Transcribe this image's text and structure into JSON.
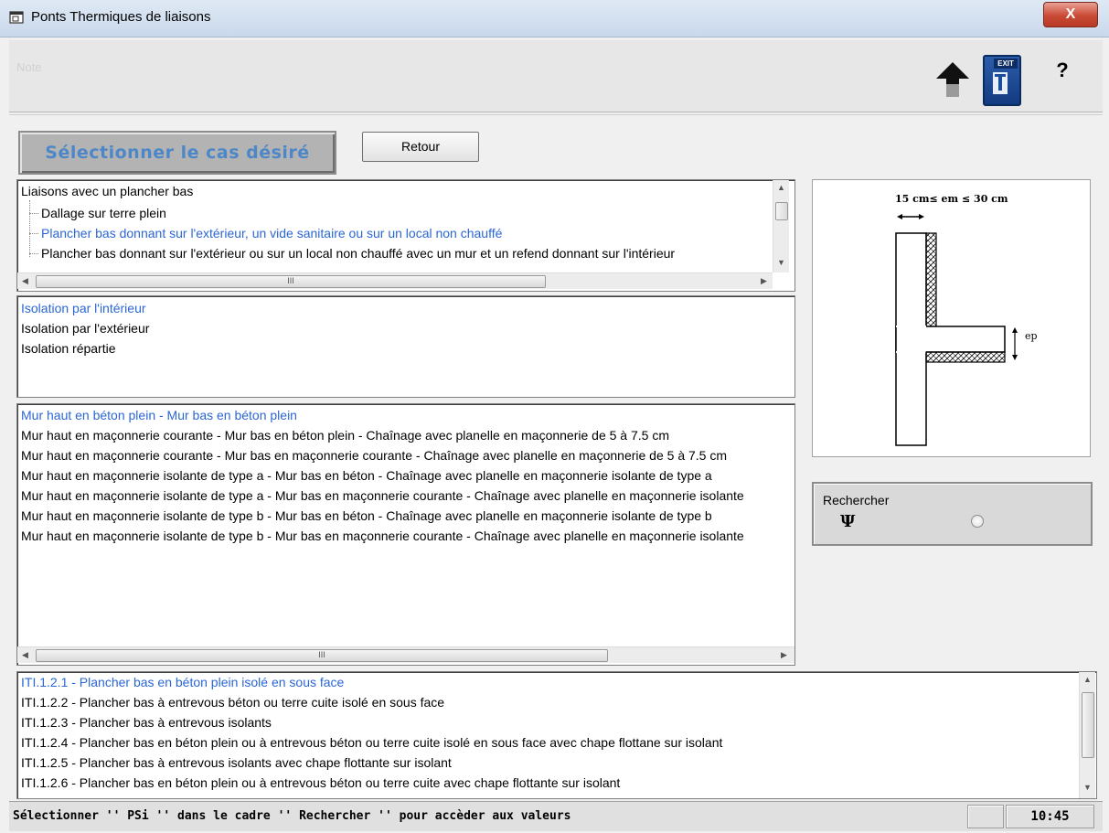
{
  "window": {
    "title": "Ponts Thermiques de liaisons",
    "close_glyph": "X",
    "header_faint_text": "Note"
  },
  "toolbar": {
    "up_icon": "up-arrow-icon",
    "exit_label": "EXIT",
    "help_glyph": "?"
  },
  "header": {
    "select_label": "Sélectionner le cas désiré",
    "retour_label": "Retour"
  },
  "liaisons_tree": {
    "root": "Liaisons avec un plancher bas",
    "children": [
      "Dallage sur terre plein",
      "Plancher bas donnant sur l'extérieur, un vide sanitaire ou sur un local non chauffé",
      "Plancher bas donnant sur l'extérieur ou sur un local non chauffé avec un mur et un refend donnant sur l'intérieur"
    ],
    "selected_index": 1
  },
  "isolation_list": {
    "items": [
      "Isolation par l'intérieur",
      "Isolation par l'extérieur",
      "Isolation répartie"
    ],
    "selected_index": 0
  },
  "mur_list": {
    "items": [
      "Mur haut en béton plein - Mur bas en béton plein",
      "Mur haut en maçonnerie courante - Mur bas en béton plein - Chaînage avec planelle en maçonnerie de 5 à 7.5 cm",
      "Mur haut en maçonnerie courante - Mur bas en maçonnerie courante - Chaînage avec planelle en maçonnerie de 5 à 7.5 cm",
      "Mur haut en maçonnerie isolante de type a - Mur bas en béton - Chaînage avec planelle en maçonnerie isolante de type a",
      "Mur haut en maçonnerie isolante de type a - Mur bas en maçonnerie courante - Chaînage avec planelle en maçonnerie isolante",
      "Mur haut en maçonnerie isolante de type b - Mur bas en béton - Chaînage avec planelle en maçonnerie isolante de type b",
      "Mur haut en maçonnerie isolante de type b - Mur bas en maçonnerie courante - Chaînage avec planelle en maçonnerie isolante"
    ],
    "selected_index": 0
  },
  "iti_list": {
    "items": [
      "ITI.1.2.1 - Plancher bas en béton plein isolé en sous face",
      "ITI.1.2.2 - Plancher bas à entrevous béton ou terre cuite isolé en sous face",
      "ITI.1.2.3 - Plancher bas à entrevous isolants",
      "ITI.1.2.4 - Plancher bas en béton plein ou à entrevous béton ou terre cuite isolé en sous face avec chape flottane sur isolant",
      "ITI.1.2.5 - Plancher bas à entrevous isolants avec chape flottante sur isolant",
      "ITI.1.2.6 - Plancher bas en béton plein ou à entrevous béton ou terre cuite avec chape flottante sur isolant"
    ],
    "selected_index": 0
  },
  "diagram": {
    "dimension_label": "15 cm≤ em ≤ 30 cm",
    "ep_label": "ep"
  },
  "search": {
    "label": "Rechercher",
    "symbol": "Ψ"
  },
  "status": {
    "message": "Sélectionner '' PSi '' dans le cadre '' Rechercher '' pour accèder aux valeurs",
    "time": "10:45"
  },
  "scrollbar": {
    "thumb_glyph": "III"
  },
  "colors": {
    "selected_text": "#2b66d6",
    "title_label": "#4d87c8"
  }
}
